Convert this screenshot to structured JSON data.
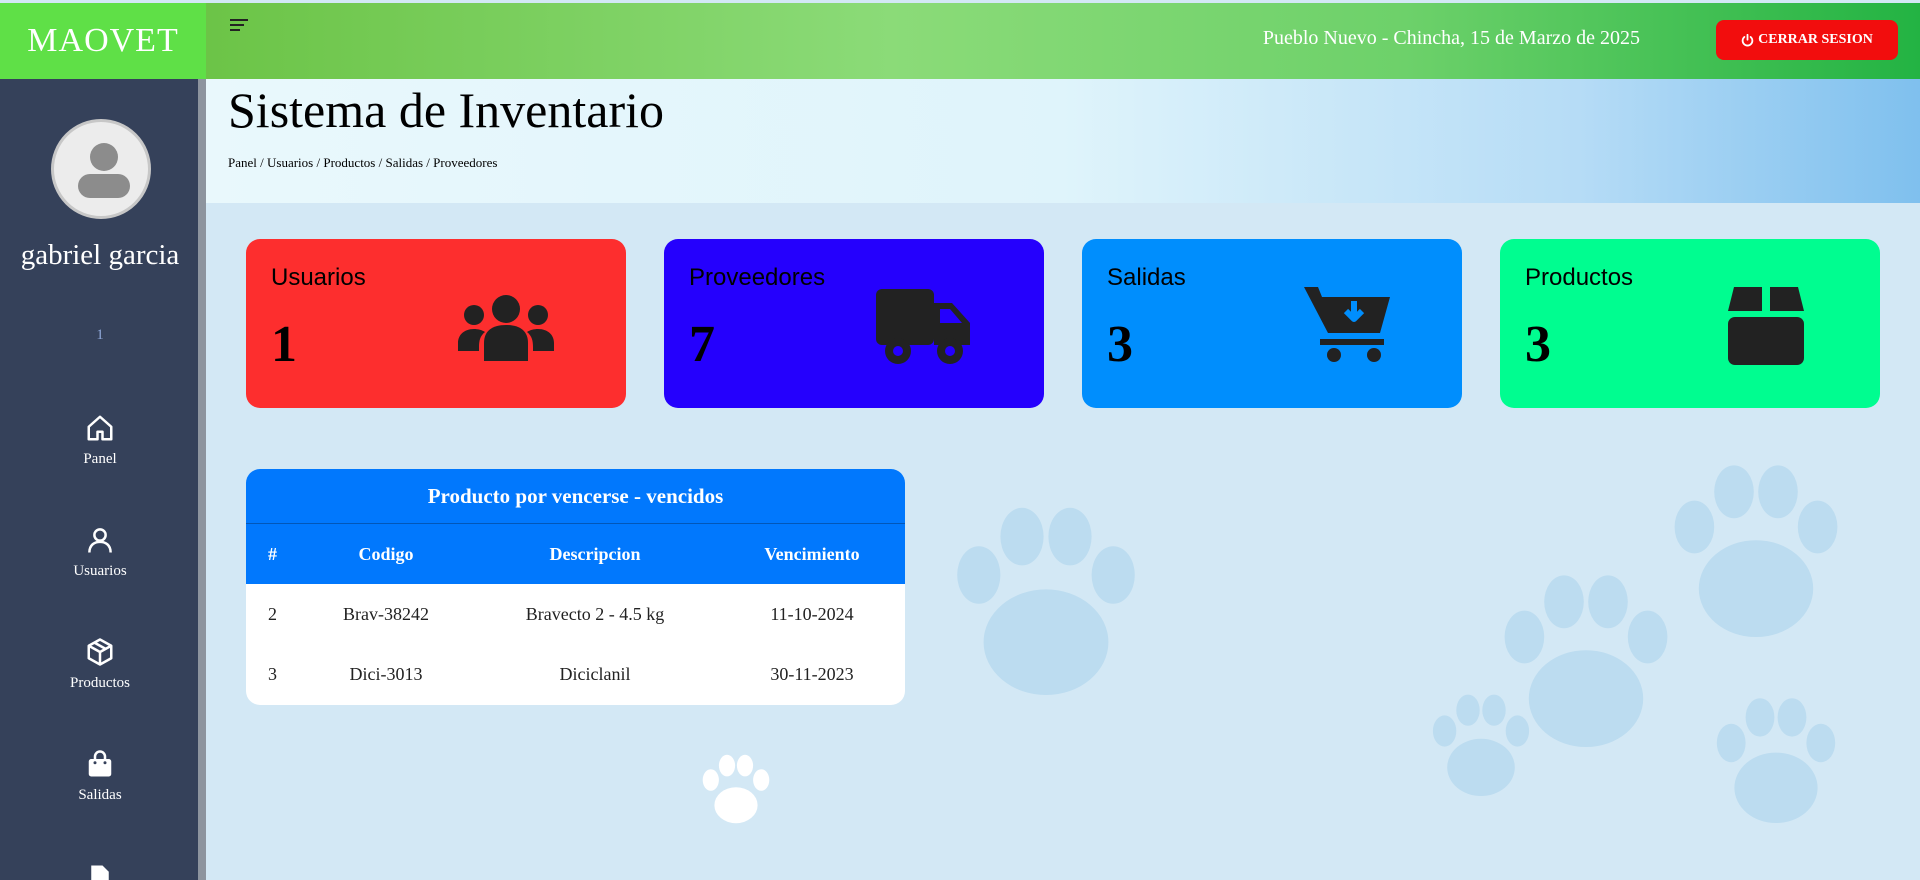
{
  "brand": "MAOVET",
  "header": {
    "location_date": "Pueblo Nuevo - Chincha, 15 de Marzo de 2025",
    "logout_label": "CERRAR SESION"
  },
  "sidebar": {
    "user_name": "gabriel garcia",
    "user_id": "1",
    "items": [
      {
        "label": "Panel",
        "icon": "home-icon"
      },
      {
        "label": "Usuarios",
        "icon": "user-icon"
      },
      {
        "label": "Productos",
        "icon": "box-icon"
      },
      {
        "label": "Salidas",
        "icon": "shopping-bag-icon"
      }
    ]
  },
  "page": {
    "title": "Sistema de Inventario",
    "breadcrumb": [
      "Panel",
      "Usuarios",
      "Productos",
      "Salidas",
      "Proveedores"
    ]
  },
  "cards": [
    {
      "label": "Usuarios",
      "value": "1",
      "color": "#fd2e2e",
      "icon": "users-icon"
    },
    {
      "label": "Proveedores",
      "value": "7",
      "color": "#2500fd",
      "icon": "truck-icon"
    },
    {
      "label": "Salidas",
      "value": "3",
      "color": "#008efd",
      "icon": "cart-download-icon"
    },
    {
      "label": "Productos",
      "value": "3",
      "color": "#00fd90",
      "icon": "box-icon"
    }
  ],
  "expiry_table": {
    "title": "Producto por vencerse - vencidos",
    "columns": [
      "#",
      "Codigo",
      "Descripcion",
      "Vencimiento"
    ],
    "rows": [
      [
        "2",
        "Brav-38242",
        "Bravecto 2 - 4.5 kg",
        "11-10-2024"
      ],
      [
        "3",
        "Dici-3013",
        "Diciclanil",
        "30-11-2023"
      ]
    ]
  },
  "colors": {
    "topbar_green": "#6cc447",
    "brand_green": "#5fe047",
    "logout_red": "#f20d0d",
    "sidebar_bg": "#35415a",
    "table_header_blue": "#0178fd"
  }
}
